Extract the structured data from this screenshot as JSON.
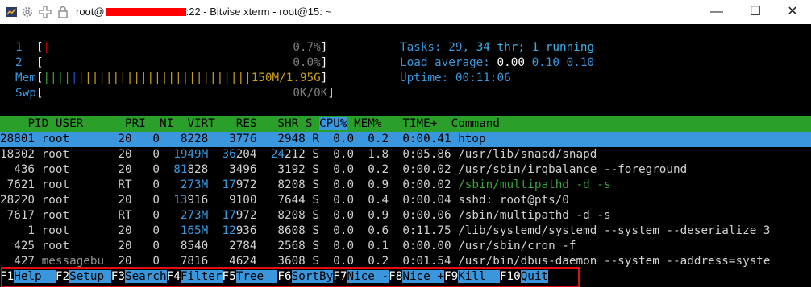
{
  "window": {
    "title_prefix": "root@",
    "title_suffix": ":22 - Bitvise xterm - root@15: ~",
    "icons": [
      "app-icon",
      "gear-icon",
      "add-icon",
      "lock-icon"
    ],
    "min_glyph": "—",
    "max_glyph": "☐",
    "close_glyph": "✕"
  },
  "meters": {
    "cpu1_label": "1",
    "cpu1_value": "0.7%",
    "cpu2_label": "2",
    "cpu2_value": "0.0%",
    "mem_label": "Mem",
    "mem_value": "150M/1.95G",
    "swp_label": "Swp",
    "swp_value": "0K/0K"
  },
  "stats": {
    "tasks_label": "Tasks:",
    "tasks_count": "29,",
    "threads": "34 thr;",
    "running": "1 running",
    "load_label": "Load average:",
    "load1": "0.00",
    "load5": "0.10",
    "load15": "0.10",
    "uptime_label": "Uptime:",
    "uptime_value": "00:11:06"
  },
  "columns": [
    "PID",
    "USER",
    "PRI",
    "NI",
    "VIRT",
    "RES",
    "SHR",
    "S",
    "CPU%",
    "MEM%",
    "TIME+",
    "Command"
  ],
  "processes": [
    {
      "pid": "28801",
      "user": "root",
      "pri": "20",
      "ni": "0",
      "virt": "8228",
      "res": "3776",
      "shr": "2948",
      "s": "R",
      "cpu": "0.0",
      "mem": "0.2",
      "time": "0:00.41",
      "cmd": "htop"
    },
    {
      "pid": "18302",
      "user": "root",
      "pri": "20",
      "ni": "0",
      "virt": "1949M",
      "res": "36204",
      "shr": "24212",
      "s": "S",
      "cpu": "0.0",
      "mem": "1.8",
      "time": "0:05.86",
      "cmd": "/usr/lib/snapd/snapd"
    },
    {
      "pid": "436",
      "user": "root",
      "pri": "20",
      "ni": "0",
      "virt": "81828",
      "res": "3496",
      "shr": "3192",
      "s": "S",
      "cpu": "0.0",
      "mem": "0.2",
      "time": "0:00.02",
      "cmd": "/usr/sbin/irqbalance --foreground"
    },
    {
      "pid": "7621",
      "user": "root",
      "pri": "RT",
      "ni": "0",
      "virt": "273M",
      "res": "17972",
      "shr": "8208",
      "s": "S",
      "cpu": "0.0",
      "mem": "0.9",
      "time": "0:00.02",
      "cmd": "/sbin/multipathd -d -s"
    },
    {
      "pid": "28220",
      "user": "root",
      "pri": "20",
      "ni": "0",
      "virt": "13916",
      "res": "9100",
      "shr": "7644",
      "s": "S",
      "cpu": "0.0",
      "mem": "0.4",
      "time": "0:00.04",
      "cmd": "sshd: root@pts/0"
    },
    {
      "pid": "7617",
      "user": "root",
      "pri": "RT",
      "ni": "0",
      "virt": "273M",
      "res": "17972",
      "shr": "8208",
      "s": "S",
      "cpu": "0.0",
      "mem": "0.9",
      "time": "0:00.06",
      "cmd": "/sbin/multipathd -d -s"
    },
    {
      "pid": "1",
      "user": "root",
      "pri": "20",
      "ni": "0",
      "virt": "165M",
      "res": "12936",
      "shr": "8608",
      "s": "S",
      "cpu": "0.0",
      "mem": "0.6",
      "time": "0:11.75",
      "cmd": "/lib/systemd/systemd --system --deserialize 3"
    },
    {
      "pid": "425",
      "user": "root",
      "pri": "20",
      "ni": "0",
      "virt": "8540",
      "res": "2784",
      "shr": "2568",
      "s": "S",
      "cpu": "0.0",
      "mem": "0.1",
      "time": "0:00.00",
      "cmd": "/usr/sbin/cron -f"
    },
    {
      "pid": "427",
      "user": "messagebu",
      "pri": "20",
      "ni": "0",
      "virt": "7816",
      "res": "4624",
      "shr": "3608",
      "s": "S",
      "cpu": "0.0",
      "mem": "0.2",
      "time": "0:01.54",
      "cmd": "/usr/bin/dbus-daemon --system --address=syste"
    }
  ],
  "fkeys": [
    {
      "key": "F1",
      "label": "Help  "
    },
    {
      "key": "F2",
      "label": "Setup "
    },
    {
      "key": "F3",
      "label": "Search"
    },
    {
      "key": "F4",
      "label": "Filter"
    },
    {
      "key": "F5",
      "label": "Tree  "
    },
    {
      "key": "F6",
      "label": "SortBy"
    },
    {
      "key": "F7",
      "label": "Nice -"
    },
    {
      "key": "F8",
      "label": "Nice +"
    },
    {
      "key": "F9",
      "label": "Kill  "
    },
    {
      "key": "F10",
      "label": "Quit"
    }
  ],
  "colors": {
    "accent": "#3a97dd",
    "header_bg": "#2aa02a",
    "highlight": "#e01010"
  }
}
